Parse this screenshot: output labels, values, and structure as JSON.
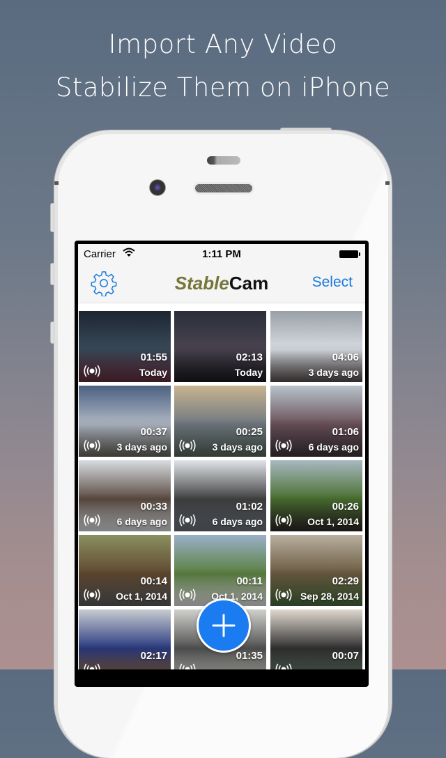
{
  "promo": {
    "line1": "Import Any Video",
    "line2": "Stabilize Them on iPhone"
  },
  "status_bar": {
    "carrier": "Carrier",
    "time": "1:11 PM",
    "wifi_icon": "wifi-icon",
    "battery_icon": "battery-icon"
  },
  "nav": {
    "settings_icon": "gear-icon",
    "title_part1": "Stable",
    "title_part2": "Cam",
    "select_label": "Select"
  },
  "colors": {
    "accent": "#1a7ae0",
    "title_olive": "#77763a",
    "fab": "#1a7cf0"
  },
  "videos": [
    {
      "duration": "01:55",
      "date": "Today",
      "stabilized": true,
      "scene": "night city street"
    },
    {
      "duration": "02:13",
      "date": "Today",
      "stabilized": false,
      "scene": "night street with car"
    },
    {
      "duration": "04:06",
      "date": "3 days ago",
      "stabilized": false,
      "scene": "train station"
    },
    {
      "duration": "00:37",
      "date": "3 days ago",
      "stabilized": true,
      "scene": "airport terminal"
    },
    {
      "duration": "00:25",
      "date": "3 days ago",
      "stabilized": true,
      "scene": "waiting lounge"
    },
    {
      "duration": "01:06",
      "date": "6 days ago",
      "stabilized": true,
      "scene": "crowd with umbrellas"
    },
    {
      "duration": "00:33",
      "date": "6 days ago",
      "stabilized": true,
      "scene": "snowy garden"
    },
    {
      "duration": "01:02",
      "date": "6 days ago",
      "stabilized": true,
      "scene": "snowy bridge"
    },
    {
      "duration": "00:26",
      "date": "Oct 1, 2014",
      "stabilized": true,
      "scene": "friends on field"
    },
    {
      "duration": "00:14",
      "date": "Oct 1, 2014",
      "stabilized": true,
      "scene": "cyclist on road"
    },
    {
      "duration": "00:11",
      "date": "Oct 1, 2014",
      "stabilized": true,
      "scene": "cyclist on grass"
    },
    {
      "duration": "02:29",
      "date": "Sep 28, 2014",
      "stabilized": true,
      "scene": "library building"
    },
    {
      "duration": "02:17",
      "date": "",
      "stabilized": true,
      "scene": "Ghin Khao storefront"
    },
    {
      "duration": "01:35",
      "date": "",
      "stabilized": true,
      "scene": "laptop on desk"
    },
    {
      "duration": "00:07",
      "date": "",
      "stabilized": true,
      "scene": "laptop with speakers"
    }
  ],
  "fab": {
    "icon": "plus-icon",
    "label": "Add video"
  }
}
